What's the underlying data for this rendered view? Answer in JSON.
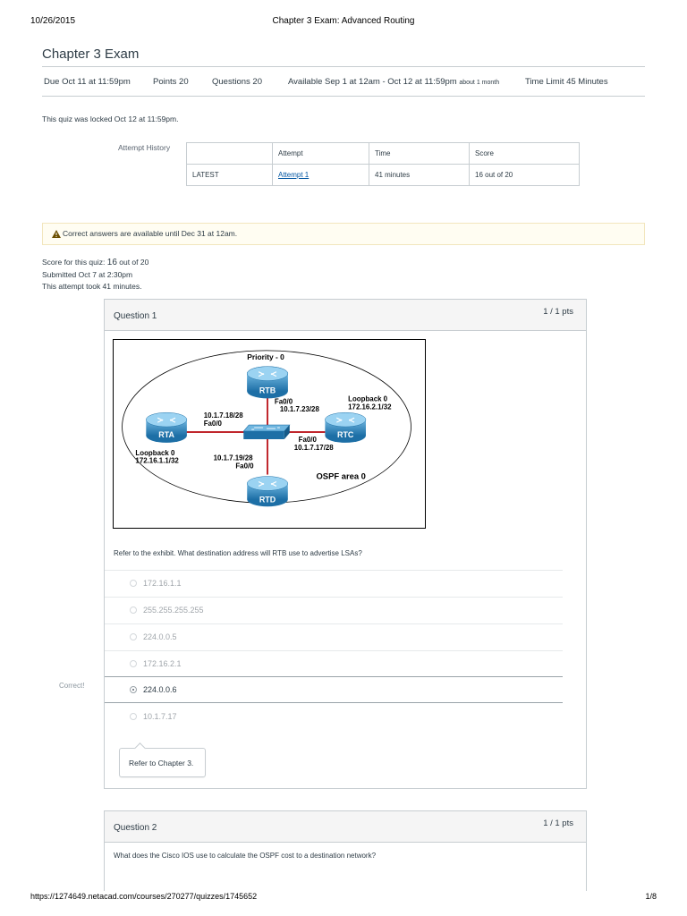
{
  "print_header": {
    "date": "10/26/2015",
    "title": "Chapter 3 Exam: Advanced Routing"
  },
  "page_title": "Chapter 3 Exam",
  "meta": {
    "due": "Due  Oct 11 at 11:59pm",
    "points": "Points  20",
    "questions": "Questions  20",
    "available": "Available  Sep 1 at 12am - Oct 12 at 11:59pm",
    "available_duration": "about 1 month",
    "time_limit": "Time Limit  45 Minutes"
  },
  "locked_message": "This quiz was locked Oct 12 at 11:59pm.",
  "attempt_history": {
    "label": "Attempt History",
    "columns": [
      "",
      "Attempt",
      "Time",
      "Score"
    ],
    "rows": [
      {
        "label": "LATEST",
        "attempt": "Attempt 1",
        "time": "41 minutes",
        "score": "16 out of 20"
      }
    ]
  },
  "alert": {
    "icon": "warning-icon",
    "text": "Correct answers are available until Dec 31 at 12am."
  },
  "score_summary": {
    "score_prefix": "Score for this quiz: ",
    "score_value": "16",
    "score_suffix": " out of 20",
    "submitted": "Submitted Oct 7 at 2:30pm",
    "duration": "This attempt took 41 minutes."
  },
  "questions": [
    {
      "name": "Question 1",
      "points": "1 / 1 pts",
      "exhibit": {
        "priority": "Priority - 0",
        "rtb": "RTB",
        "rta": "RTA",
        "rtc": "RTC",
        "rtd": "RTD",
        "rtb_if": "Fa0/0",
        "rtb_ip": "10.1.7.23/28",
        "rta_ip": "10.1.7.18/28",
        "rta_if": "Fa0/0",
        "rta_loop": "Loopback 0",
        "rta_loop_ip": "172.16.1.1/32",
        "rtc_loop": "Loopback 0",
        "rtc_loop_ip": "172.16.2.1/32",
        "rtc_if": "Fa0/0",
        "rtc_ip": "10.1.7.17/28",
        "rtd_ip": "10.1.7.19/28",
        "rtd_if": "Fa0/0",
        "area": "OSPF area 0"
      },
      "text": "Refer to the exhibit. What destination address will RTB use to advertise LSAs?",
      "correct_label": "Correct!",
      "answers": [
        "172.16.1.1",
        "255.255.255.255",
        "224.0.0.5",
        "172.16.2.1",
        "224.0.0.6",
        "10.1.7.17"
      ],
      "comment": "Refer to Chapter 3."
    },
    {
      "name": "Question 2",
      "points": "1 / 1 pts",
      "text": "What does the Cisco IOS use to calculate the OSPF cost to a destination network?"
    }
  ],
  "footer": {
    "url": "https://1274649.netacad.com/courses/270277/quizzes/1745652",
    "page": "1/8"
  },
  "colors": {
    "router": "#2f8fc7",
    "link": "#c0262c",
    "accent_link": "#0055a2"
  }
}
